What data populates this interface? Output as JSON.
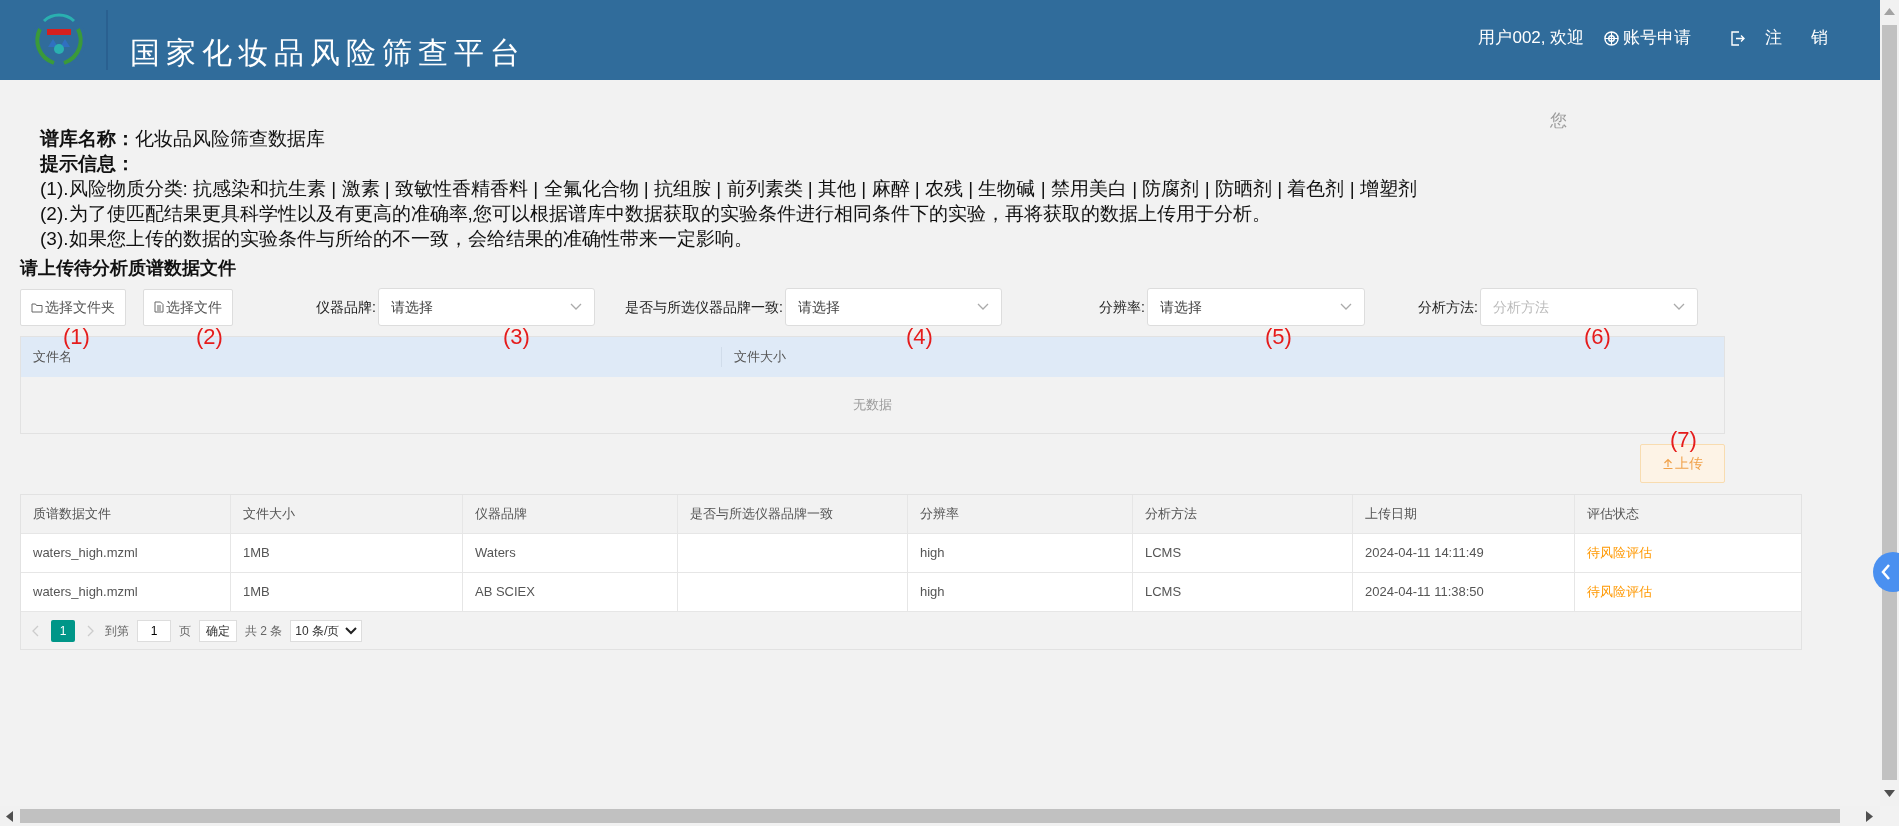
{
  "header": {
    "title": "国家化妆品风险筛查平台",
    "welcome": "用户002, 欢迎",
    "apply_link": "账号申请",
    "logout_link": "注 销"
  },
  "stray_text": "您",
  "info": {
    "name_label": "谱库名称：",
    "name_value": "化妆品风险筛查数据库",
    "hint_label": "提示信息：",
    "lines": [
      "(1).风险物质分类: 抗感染和抗生素 | 激素 | 致敏性香精香料 | 全氟化合物 | 抗组胺 | 前列素类 | 其他 | 麻醉 | 农残 | 生物碱 | 禁用美白 | 防腐剂 | 防晒剂 | 着色剂 | 增塑剂",
      "(2).为了使匹配结果更具科学性以及有更高的准确率,您可以根据谱库中数据获取的实验条件进行相同条件下的实验，再将获取的数据上传用于分析。",
      "(3).如果您上传的数据的实验条件与所给的不一致，会给结果的准确性带来一定影响。"
    ]
  },
  "upload": {
    "heading": "请上传待分析质谱数据文件",
    "buttons": [
      {
        "label": "选择文件夹",
        "kind": "folder"
      },
      {
        "label": "选择文件",
        "kind": "file"
      }
    ],
    "filters": [
      {
        "label": "仪器品牌:",
        "value": "请选择"
      },
      {
        "label": "是否与所选仪器品牌一致:",
        "value": "请选择"
      },
      {
        "label": "分辨率:",
        "value": "请选择"
      },
      {
        "label": "分析方法:",
        "placeholder": "分析方法"
      }
    ],
    "annotations": [
      "(1)",
      "(2)",
      "(3)",
      "(4)",
      "(5)",
      "(6)",
      "(7)"
    ],
    "file_table": {
      "columns": [
        "文件名",
        "文件大小"
      ],
      "empty_text": "无数据"
    },
    "upload_button": {
      "label": "上传",
      "disabled": true
    }
  },
  "records": {
    "columns": [
      "质谱数据文件",
      "文件大小",
      "仪器品牌",
      "是否与所选仪器品牌一致",
      "分辨率",
      "分析方法",
      "上传日期",
      "评估状态"
    ],
    "rows": [
      {
        "file": "waters_high.mzml",
        "size": "1MB",
        "brand": "Waters",
        "resolution": "high",
        "method": "LCMS",
        "date": "2024-04-11 14:11:49",
        "status": "待风险评估"
      },
      {
        "file": "waters_high.mzml",
        "size": "1MB",
        "brand": "AB SCIEX",
        "resolution": "high",
        "method": "LCMS",
        "date": "2024-04-11 11:38:50",
        "status": "待风险评估"
      }
    ],
    "pagination": {
      "pages": [
        {
          "label": "1",
          "selected": true
        }
      ],
      "goto_label": "到第",
      "goto_value": "1",
      "page_unit": "页",
      "confirm": "确定",
      "total": "共 2 条",
      "page_size": "10 条/页"
    }
  }
}
